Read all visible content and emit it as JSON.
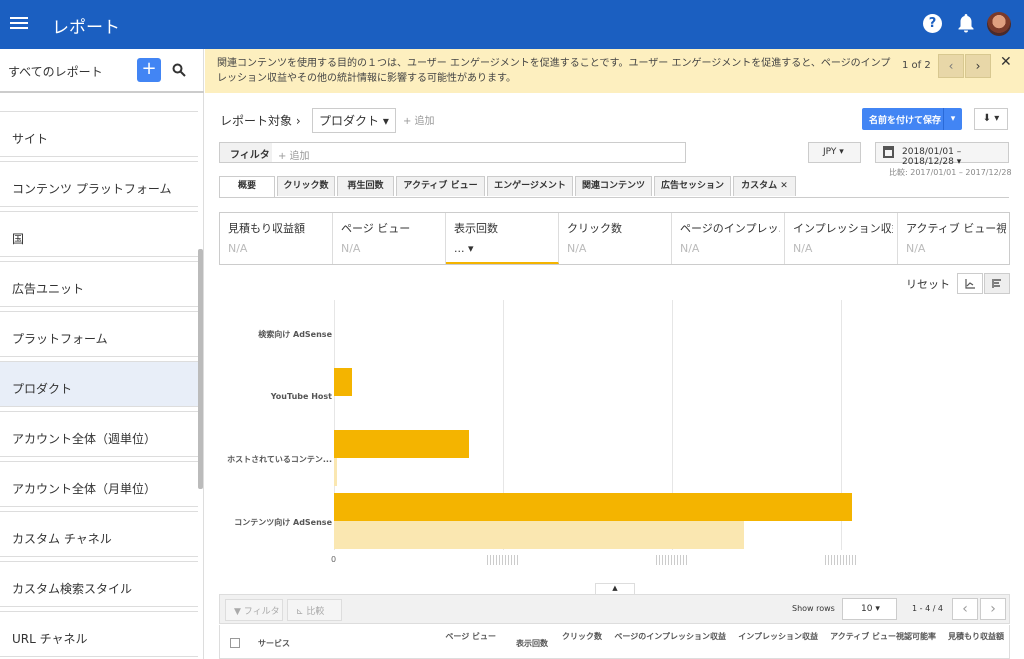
{
  "app": {
    "title": "レポート"
  },
  "sidebar": {
    "header": "すべてのレポート",
    "add_label": "+",
    "items": [
      {
        "label": "サイト"
      },
      {
        "label": "コンテンツ プラットフォーム"
      },
      {
        "label": "国"
      },
      {
        "label": "広告ユニット"
      },
      {
        "label": "プラットフォーム"
      },
      {
        "label": "プロダクト"
      },
      {
        "label": "アカウント全体（週単位）"
      },
      {
        "label": "アカウント全体（月単位）"
      },
      {
        "label": "カスタム チャネル"
      },
      {
        "label": "カスタム検索スタイル"
      },
      {
        "label": "URL チャネル"
      }
    ]
  },
  "banner": {
    "message": "関連コンテンツを使用する目的の１つは、ユーザー エンゲージメントを促進することです。ユーザー エンゲージメントを促進すると、ページのインプレッション収益やその他の統計情報に影響する可能性があります。",
    "page": "1 of 2"
  },
  "report": {
    "target_label": "レポート対象",
    "dimension": "プロダクト",
    "add": "+ 追加",
    "save_label": "名前を付けて保存",
    "filter_label": "フィルタ",
    "filter_add": "+ 追加",
    "currency": "JPY",
    "date_range": "2018/01/01 – 2018/12/28",
    "compare": "比較: 2017/01/01 – 2017/12/28"
  },
  "tabs": [
    "概要",
    "クリック数",
    "再生回数",
    "アクティブ ビュー",
    "エンゲージメント",
    "関連コンテンツ",
    "広告セッション",
    "カスタム"
  ],
  "metrics": [
    {
      "name": "見積もり収益額",
      "value": "N/A"
    },
    {
      "name": "ページ ビュー",
      "value": "N/A"
    },
    {
      "name": "表示回数",
      "value": "..."
    },
    {
      "name": "クリック数",
      "value": "N/A"
    },
    {
      "name": "ページのインプレッ...",
      "value": "N/A"
    },
    {
      "name": "インプレッション収益",
      "value": "N/A"
    },
    {
      "name": "アクティブ ビュー視...",
      "value": "N/A"
    }
  ],
  "chart_controls": {
    "reset": "リセット"
  },
  "chart_data": {
    "type": "bar",
    "orientation": "horizontal",
    "categories": [
      "検索向け AdSense",
      "YouTube Host",
      "ホストされているコンテン...",
      "コンテンツ向け AdSense"
    ],
    "series": [
      {
        "values": [
          0,
          13,
          100,
          383
        ],
        "color": "#f4b400"
      },
      {
        "values": [
          0,
          0,
          2,
          303
        ],
        "color": "#fae7b1"
      }
    ],
    "x_ticks": [
      "0"
    ],
    "xlim": [
      0,
      500
    ],
    "grid": true
  },
  "table": {
    "filter_btn": "フィルタ",
    "compare_btn": "比較",
    "show_rows_label": "Show rows",
    "rows": "10",
    "range": "1 - 4 / 4",
    "headers": [
      "サービス",
      "ページ ビュー",
      "表示回数",
      "クリック数",
      "ページのインプレッション収益",
      "インプレッション収益",
      "アクティブ ビュー視認可能率",
      "見積もり収益額"
    ]
  }
}
